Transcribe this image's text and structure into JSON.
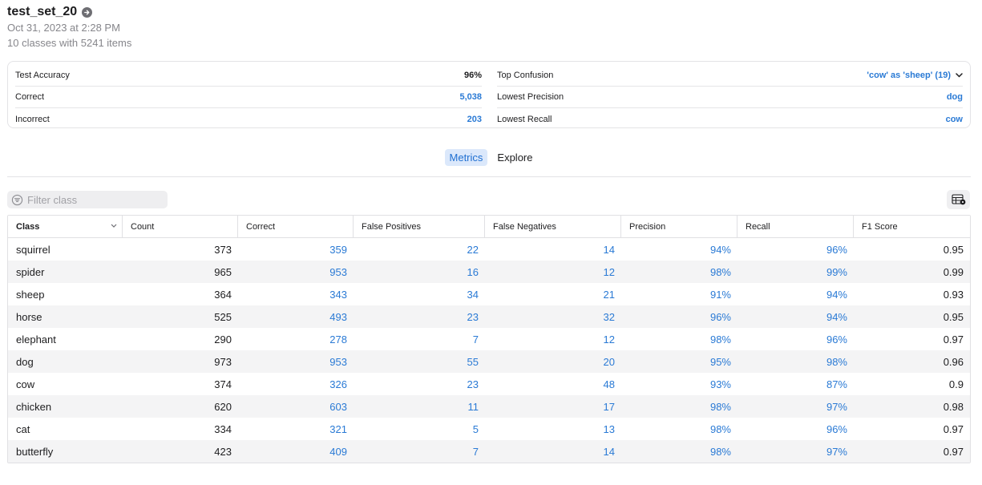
{
  "header": {
    "title": "test_set_20",
    "date": "Oct 31, 2023 at 2:28 PM",
    "summary": "10 classes with 5241 items"
  },
  "summary": {
    "left": [
      {
        "label": "Test Accuracy",
        "value": "96%"
      },
      {
        "label": "Correct",
        "value": "5,038"
      },
      {
        "label": "Incorrect",
        "value": "203"
      }
    ],
    "right": [
      {
        "label": "Top Confusion",
        "value": "'cow' as 'sheep' (19)"
      },
      {
        "label": "Lowest Precision",
        "value": "dog"
      },
      {
        "label": "Lowest Recall",
        "value": "cow"
      }
    ]
  },
  "tabs": [
    "Metrics",
    "Explore"
  ],
  "active_tab": "Metrics",
  "filter": {
    "placeholder": "Filter class",
    "value": ""
  },
  "icons": {
    "title": "arrow-right-circle-icon",
    "confusion": "chevron-down-icon",
    "filter": "filter-icon",
    "table_settings": "table-settings-icon",
    "sort": "chevron-down-icon"
  },
  "colors": {
    "accent": "#2a7ad5",
    "tab_active_bg": "#dbe8fb",
    "row_alt": "#f4f4f5",
    "border": "#e0e0e3"
  },
  "table": {
    "columns": [
      "Class",
      "Count",
      "Correct",
      "False Positives",
      "False Negatives",
      "Precision",
      "Recall",
      "F1 Score"
    ],
    "sorted_column": "Class",
    "rows": [
      [
        "squirrel",
        "373",
        "359",
        "22",
        "14",
        "94%",
        "96%",
        "0.95"
      ],
      [
        "spider",
        "965",
        "953",
        "16",
        "12",
        "98%",
        "99%",
        "0.99"
      ],
      [
        "sheep",
        "364",
        "343",
        "34",
        "21",
        "91%",
        "94%",
        "0.93"
      ],
      [
        "horse",
        "525",
        "493",
        "23",
        "32",
        "96%",
        "94%",
        "0.95"
      ],
      [
        "elephant",
        "290",
        "278",
        "7",
        "12",
        "98%",
        "96%",
        "0.97"
      ],
      [
        "dog",
        "973",
        "953",
        "55",
        "20",
        "95%",
        "98%",
        "0.96"
      ],
      [
        "cow",
        "374",
        "326",
        "23",
        "48",
        "93%",
        "87%",
        "0.9"
      ],
      [
        "chicken",
        "620",
        "603",
        "11",
        "17",
        "98%",
        "97%",
        "0.98"
      ],
      [
        "cat",
        "334",
        "321",
        "5",
        "13",
        "98%",
        "96%",
        "0.97"
      ],
      [
        "butterfly",
        "423",
        "409",
        "7",
        "14",
        "98%",
        "97%",
        "0.97"
      ]
    ]
  }
}
